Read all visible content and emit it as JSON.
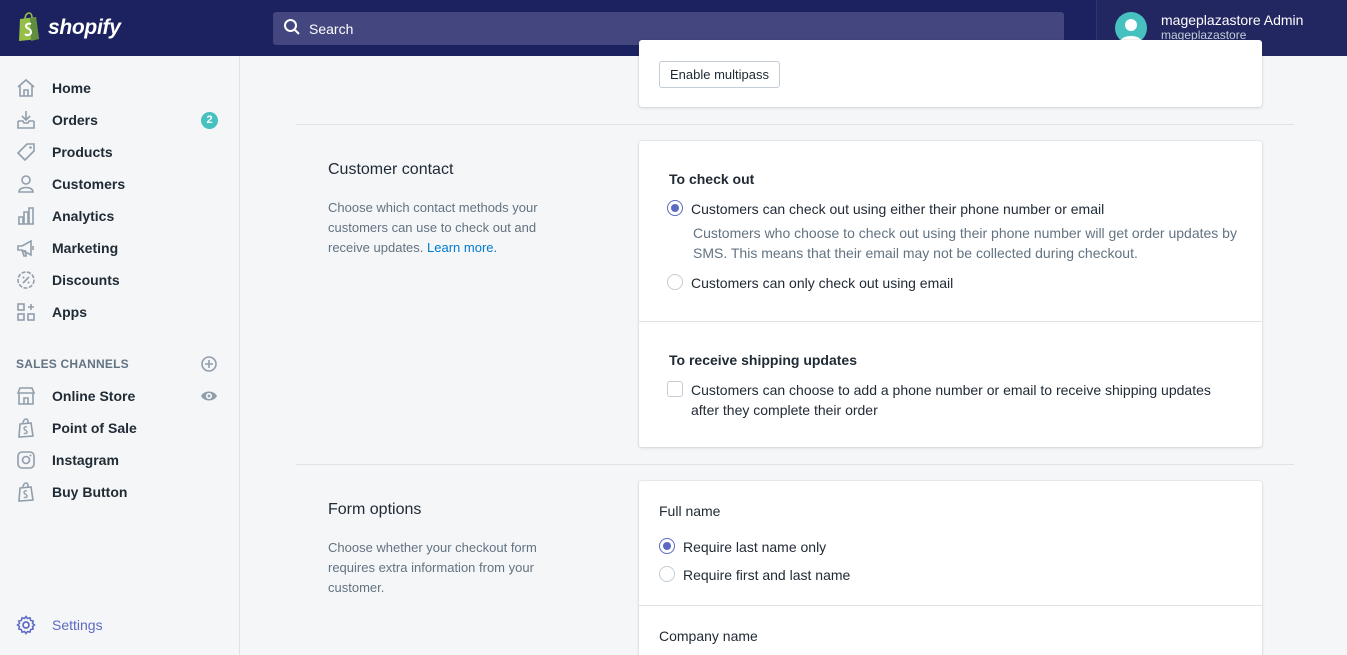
{
  "brand": {
    "name": "shopify"
  },
  "search": {
    "placeholder": "Search"
  },
  "account": {
    "name": "mageplazastore Admin",
    "store": "mageplazastore"
  },
  "sidebar": {
    "items": [
      {
        "label": "Home",
        "icon": "home-icon"
      },
      {
        "label": "Orders",
        "icon": "orders-icon",
        "badge": "2"
      },
      {
        "label": "Products",
        "icon": "tag-icon"
      },
      {
        "label": "Customers",
        "icon": "person-icon"
      },
      {
        "label": "Analytics",
        "icon": "bar-chart-icon"
      },
      {
        "label": "Marketing",
        "icon": "megaphone-icon"
      },
      {
        "label": "Discounts",
        "icon": "discount-icon"
      },
      {
        "label": "Apps",
        "icon": "apps-icon"
      }
    ],
    "channels_heading": "SALES CHANNELS",
    "channels": [
      {
        "label": "Online Store",
        "icon": "store-icon"
      },
      {
        "label": "Point of Sale",
        "icon": "shopify-bag-icon"
      },
      {
        "label": "Instagram",
        "icon": "instagram-icon"
      },
      {
        "label": "Buy Button",
        "icon": "shopify-bag-icon"
      }
    ],
    "settings": "Settings"
  },
  "multipass": {
    "button": "Enable multipass"
  },
  "customer_contact": {
    "title": "Customer contact",
    "description": "Choose which contact methods your customers can use to check out and receive updates.",
    "learn_more": "Learn more.",
    "checkout_heading": "To check out",
    "option_phone_or_email": "Customers can check out using either their phone number or email",
    "option_phone_help": "Customers who choose to check out using their phone number will get order updates by SMS. This means that their email may not be collected during checkout.",
    "option_email_only": "Customers can only check out using email",
    "shipping_heading": "To receive shipping updates",
    "shipping_option": "Customers can choose to add a phone number or email to receive shipping updates after they complete their order"
  },
  "form_options": {
    "title": "Form options",
    "description": "Choose whether your checkout form requires extra information from your customer.",
    "full_name_label": "Full name",
    "option_last_only": "Require last name only",
    "option_first_last": "Require first and last name",
    "company_label": "Company name"
  },
  "colors": {
    "topbar": "#1c2260",
    "accent": "#5c6ac4",
    "badge": "#47c1bf",
    "link": "#007ace"
  }
}
